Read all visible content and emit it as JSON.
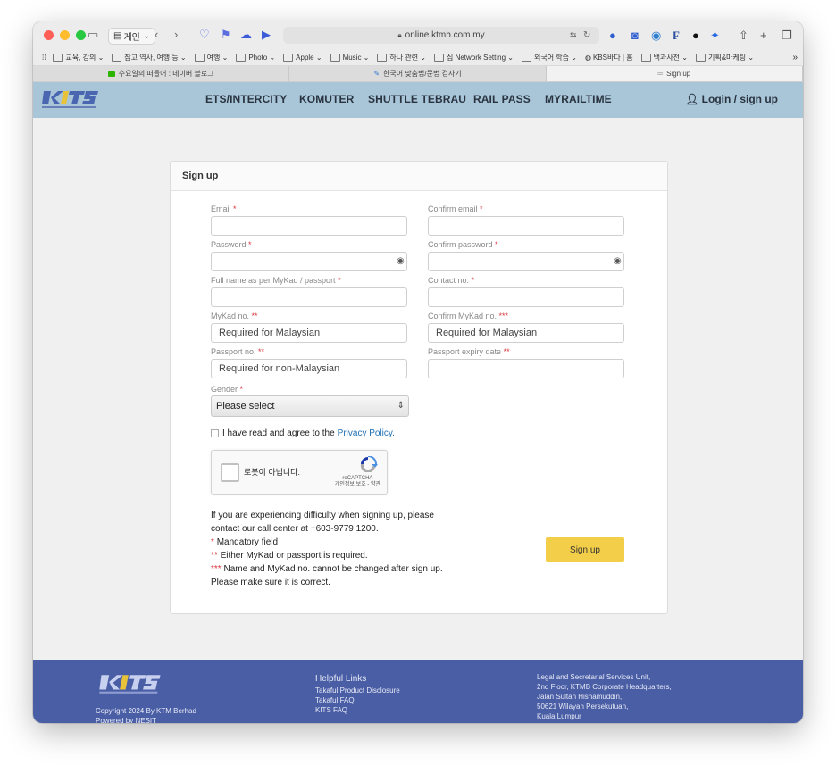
{
  "browser": {
    "tab_group_label": "게인",
    "url": "online.ktmb.com.my",
    "bookmarks": [
      "교육, 강의",
      "참고 역사, 여행 등",
      "여행",
      "Photo",
      "Apple",
      "Music",
      "하나 관련",
      "집 Network Setting",
      "외국어 학습",
      "KBS바다 | 홈",
      "백과사전",
      "기획&마케팅"
    ],
    "tabs": [
      "수요일의 떠들어 : 네이버 블로그",
      "한국어 맞춤법/문법 검사기",
      "Sign up"
    ]
  },
  "nav": {
    "items": [
      "ETS/INTERCITY",
      "KOMUTER",
      "SHUTTLE TEBRAU",
      "RAIL PASS",
      "MYRAILTIME"
    ],
    "login": "Login / sign up"
  },
  "form": {
    "title": "Sign up",
    "email_label": "Email",
    "confirm_email_label": "Confirm email",
    "password_label": "Password",
    "confirm_password_label": "Confirm password",
    "fullname_label": "Full name as per MyKad / passport",
    "contact_label": "Contact no.",
    "mykad_label": "MyKad no.",
    "confirm_mykad_label": "Confirm MyKad no.",
    "passport_label": "Passport no.",
    "passport_expiry_label": "Passport expiry date",
    "gender_label": "Gender",
    "req1": "*",
    "req2": "**",
    "req3": "***",
    "mykad_placeholder": "Required for Malaysian",
    "confirm_mykad_placeholder": "Required for Malaysian",
    "passport_placeholder": "Required for non-Malaysian",
    "gender_value": "Please select",
    "agree_text": "I have read and agree to the",
    "privacy_link": "Privacy Policy.",
    "captcha_text": "로봇이 아닙니다.",
    "captcha_brand": "reCAPTCHA",
    "captcha_terms": "개인정보 보호 - 약관",
    "info_line1": "If you are experiencing difficulty when signing up, please",
    "info_line2": "contact our call center at +603-9779 1200.",
    "note_mandatory": "Mandatory field",
    "note_either": "Either MyKad or passport is required.",
    "note_name": "Name and MyKad no. cannot be changed after sign up.",
    "note_sure": "Please make sure it is correct.",
    "signup_button": "Sign up"
  },
  "footer": {
    "copyright": "Copyright 2024 By KTM Berhad",
    "powered": "Powered by NESIT",
    "links_title": "Helpful Links",
    "links": [
      "Takaful Product Disclosure",
      "Takaful FAQ",
      "KITS FAQ"
    ],
    "address": [
      "Legal and Secretarial Services Unit,",
      "2nd Floor, KTMB Corporate Headquarters,",
      "Jalan Sultan Hishamuddin,",
      "50621 Wilayah Persekutuan,",
      "Kuala Lumpur"
    ]
  },
  "colors": {
    "nav_bg": "#a9c6d9",
    "footer_bg": "#4a5ea6",
    "button_bg": "#f3ce49",
    "required": "#d9363e",
    "link": "#1f6fb2"
  }
}
